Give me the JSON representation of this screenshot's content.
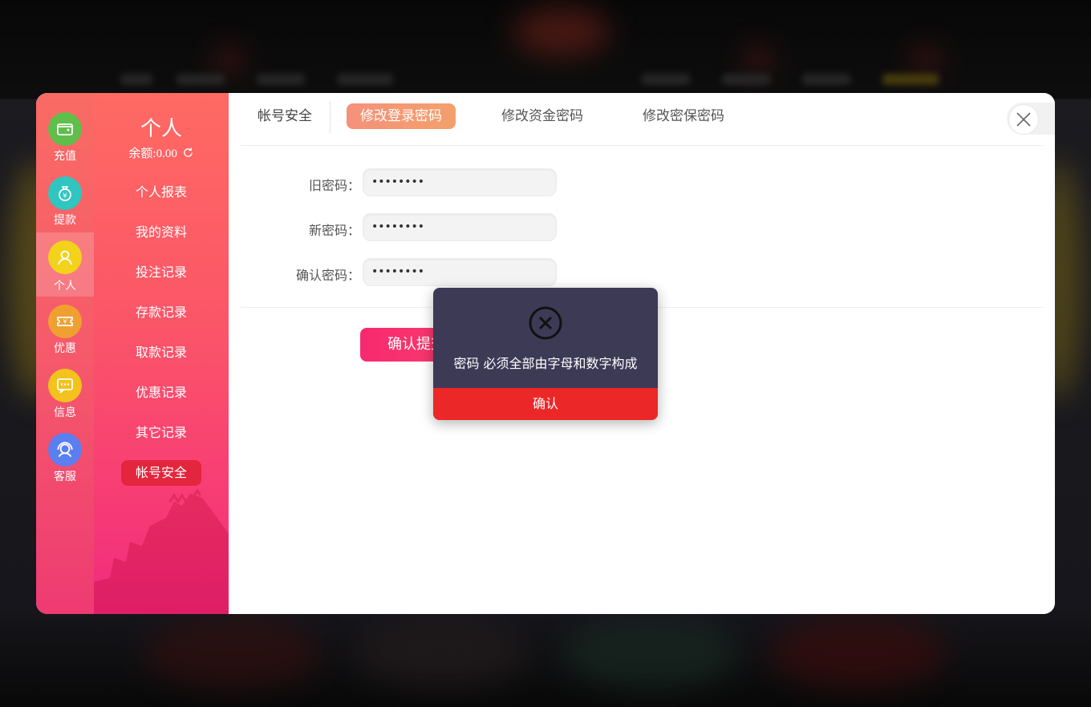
{
  "rail": {
    "items": [
      {
        "label": "充值",
        "icon": "wallet-icon",
        "color": "#5fbf4a"
      },
      {
        "label": "提款",
        "icon": "money-bag-icon",
        "color": "#2fc6c0"
      },
      {
        "label": "个人",
        "icon": "user-icon",
        "color": "#f3d21c"
      },
      {
        "label": "优惠",
        "icon": "coupon-icon",
        "color": "#f0a030"
      },
      {
        "label": "信息",
        "icon": "message-icon",
        "color": "#f3c21c"
      },
      {
        "label": "客服",
        "icon": "headset-icon",
        "color": "#5b7ef0"
      }
    ]
  },
  "sidebar": {
    "title": "个人",
    "balance": "余额:0.00",
    "items": [
      {
        "label": "个人报表"
      },
      {
        "label": "我的资料"
      },
      {
        "label": "投注记录"
      },
      {
        "label": "存款记录"
      },
      {
        "label": "取款记录"
      },
      {
        "label": "优惠记录"
      },
      {
        "label": "其它记录"
      },
      {
        "label": "帐号安全"
      }
    ]
  },
  "tabs": {
    "section": "帐号安全",
    "items": [
      {
        "label": "修改登录密码"
      },
      {
        "label": "修改资金密码"
      },
      {
        "label": "修改密保密码"
      }
    ]
  },
  "form": {
    "old_label": "旧密码：",
    "old_value": "••••••••",
    "new_label": "新密码：",
    "new_value": "••••••••",
    "confirm_label": "确认密码：",
    "confirm_value": "••••••••",
    "submit_label": "确认提交"
  },
  "alert": {
    "message": "密码 必须全部由字母和数字构成",
    "ok_label": "确认"
  },
  "colors": {
    "accent": "#f7296f",
    "active_pill": "#f5917a",
    "alert_bg": "#3d3a56",
    "alert_ok": "#ec2727"
  }
}
